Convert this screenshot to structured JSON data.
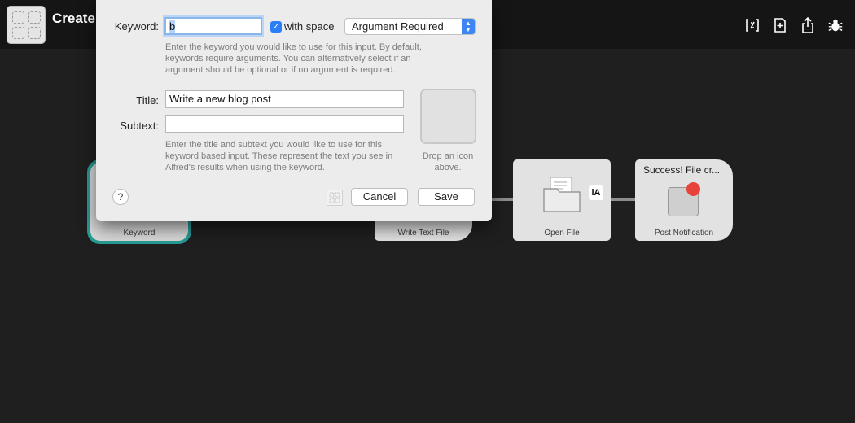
{
  "topbar": {
    "title": "Create",
    "icons": [
      "variable-icon",
      "add-object-icon",
      "share-icon",
      "debug-bug-icon"
    ]
  },
  "canvas": {
    "nodes": {
      "keyword": {
        "label": "Keyword"
      },
      "write_text_file": {
        "label": "Write Text File"
      },
      "open_file": {
        "label": "Open File",
        "badge": "iA"
      },
      "post_notification": {
        "title": "Success! File cr...",
        "label": "Post Notification"
      }
    },
    "accent_color": "#279b95"
  },
  "dialog": {
    "keyword_label": "Keyword:",
    "keyword_value": "b",
    "with_space_checked": true,
    "with_space_label": "with space",
    "argument_option": "Argument Required",
    "keyword_help": "Enter the keyword you would like to use for this input. By default, keywords require arguments. You can alternatively select if an argument should be optional or if no argument is required.",
    "title_label": "Title:",
    "title_value": "Write a new blog post",
    "subtext_label": "Subtext:",
    "subtext_value": "",
    "title_help": "Enter the title and subtext you would like to use for this keyword based input. These represent the text you see in Alfred's results when using the keyword.",
    "drop_icon_text": "Drop an icon above.",
    "help_label": "?",
    "cancel_label": "Cancel",
    "save_label": "Save"
  }
}
